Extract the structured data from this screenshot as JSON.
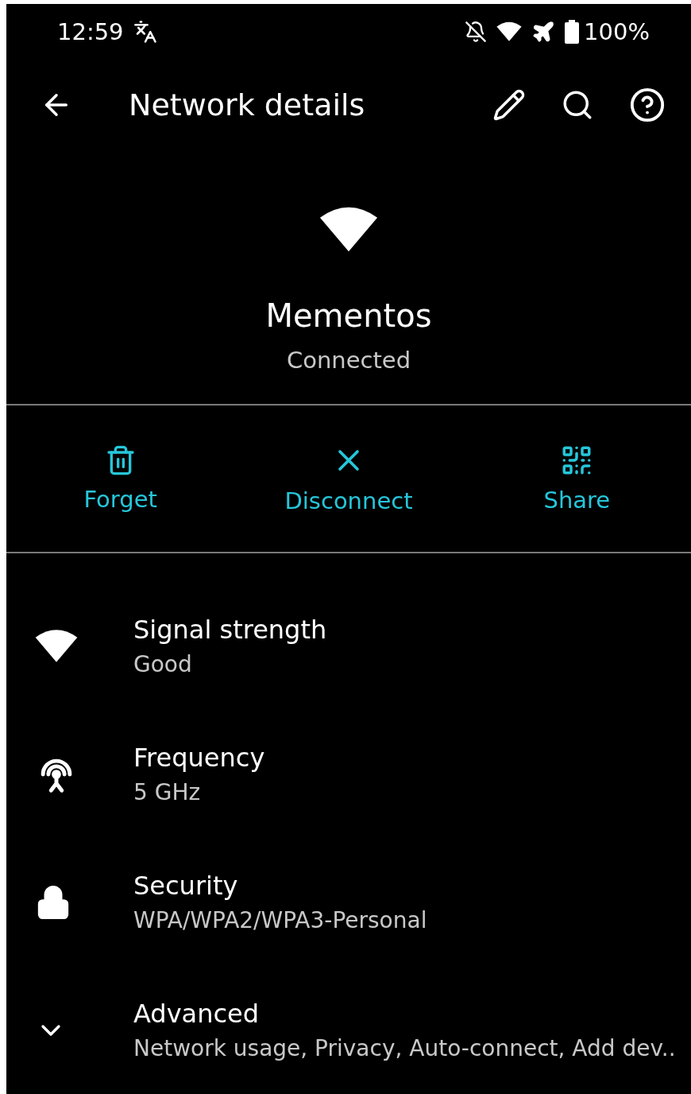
{
  "status_bar": {
    "time": "12:59",
    "battery": "100%"
  },
  "toolbar": {
    "title": "Network details"
  },
  "network": {
    "name": "Mementos",
    "status": "Connected"
  },
  "actions": [
    {
      "kind": "forget",
      "label": "Forget"
    },
    {
      "kind": "disconnect",
      "label": "Disconnect"
    },
    {
      "kind": "share",
      "label": "Share"
    }
  ],
  "details": [
    {
      "kind": "signal",
      "title": "Signal strength",
      "value": "Good"
    },
    {
      "kind": "frequency",
      "title": "Frequency",
      "value": "5 GHz"
    },
    {
      "kind": "security",
      "title": "Security",
      "value": "WPA/WPA2/WPA3-Personal"
    },
    {
      "kind": "advanced",
      "title": "Advanced",
      "value": "Network usage, Privacy, Auto-connect, Add dev.."
    }
  ]
}
